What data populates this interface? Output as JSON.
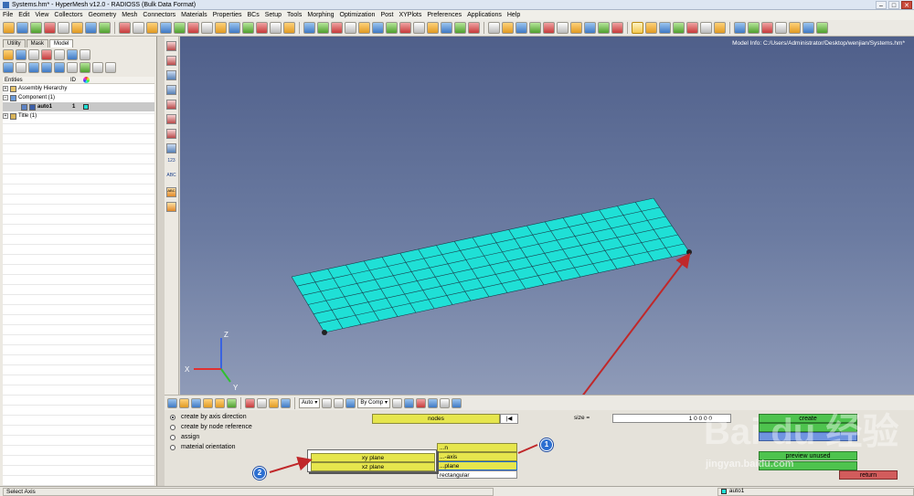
{
  "window": {
    "title": "Systems.hm* - HyperMesh v12.0 - RADIOSS (Bulk Data Format)",
    "min": "–",
    "max": "□",
    "close": "✕"
  },
  "menu": [
    "File",
    "Edit",
    "View",
    "Collectors",
    "Geometry",
    "Mesh",
    "Connectors",
    "Materials",
    "Properties",
    "BCs",
    "Setup",
    "Tools",
    "Morphing",
    "Optimization",
    "Post",
    "XYPlots",
    "Preferences",
    "Applications",
    "Help"
  ],
  "left": {
    "tabs": [
      "Utility",
      "Mask",
      "Model"
    ],
    "active_tab": "Model",
    "columns": {
      "entities": "Entities",
      "id": "ID"
    },
    "tree": [
      {
        "label": "Assembly Hierarchy",
        "level": 0,
        "expander": "+"
      },
      {
        "label": "Component (1)",
        "level": 0,
        "expander": "−"
      },
      {
        "label": "auto1",
        "level": 2,
        "id": "1",
        "selected": true,
        "color": "#1fe0d6"
      },
      {
        "label": "Title (1)",
        "level": 0,
        "expander": "+"
      }
    ]
  },
  "vtools_labels": {
    "t1": "123",
    "t2": "ABC",
    "t3": "ABC"
  },
  "viewport": {
    "model_info": "Model Info: C:/Users/Administrator/Desktop/wenjian/Systems.hm*",
    "axes": {
      "x": "X",
      "y": "Y",
      "z": "Z"
    },
    "background_top": "#4f5f8a",
    "mesh_color": "#1fe0d6"
  },
  "bottom_toolbar": {
    "auto_label": "Auto",
    "color_by_label": "By Comp"
  },
  "panel": {
    "radios": [
      {
        "label": "create by axis direction",
        "checked": true
      },
      {
        "label": "create by node reference",
        "checked": false
      },
      {
        "label": "assign",
        "checked": false
      },
      {
        "label": "material orientation",
        "checked": false
      }
    ],
    "nodes_label": "nodes",
    "reset_glyph": "|◀",
    "size_label": "size =",
    "size_value": "1 0   0 0 0",
    "axis_options": [
      "...n",
      "...-axis",
      "...plane",
      "rectangular"
    ],
    "create_label": "create",
    "preview_label": "preview unused",
    "return_label": "return"
  },
  "popup": {
    "options": [
      "xy plane",
      "xz plane"
    ]
  },
  "badges": {
    "one": "1",
    "two": "2"
  },
  "status": {
    "message": "Select Axis",
    "component": "auto1"
  },
  "watermark": {
    "brand": "Bai du 经验",
    "url": "jingyan.baidu.com"
  }
}
